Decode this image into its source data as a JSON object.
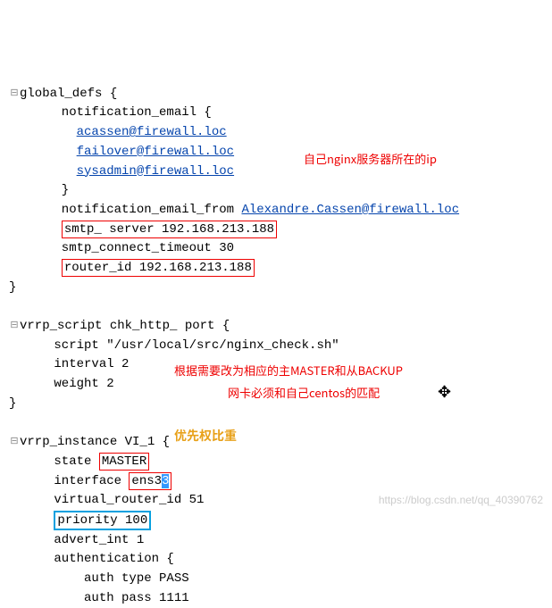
{
  "lines": {
    "l1a": "global_defs {",
    "l2": "       notification_email {",
    "l3": "         ",
    "l3b": "acassen@firewall.loc",
    "l4": "         ",
    "l4b": "failover@firewall.loc",
    "l5": "         ",
    "l5b": "sysadmin@firewall.loc",
    "l6": "       }",
    "l7": "       notification_email_from ",
    "l7b": "Alexandre.Cassen@firewall.loc",
    "l8": "smtp_ server 192.168.213.188",
    "l9": "       smtp_connect_timeout 30",
    "l10": "router_id 192.168.213.188",
    "l11": "}",
    "l12": "vrrp_script chk_http_ port {",
    "l13": "      script \"/usr/local/src/nginx_check.sh\"",
    "l14": "      interval 2",
    "l15": "      weight 2",
    "l16": "}",
    "l17": "vrrp_instance VI_1 {",
    "l18a": "      state ",
    "l18b": "MASTER",
    "l19a": "      interface ",
    "l19b": "ens3",
    "l19c": "3",
    "l20": "      virtual_router_id 51",
    "l21": "priority 100",
    "l22": "      advert_int 1",
    "l23": "      authentication {",
    "l24": "          auth type PASS",
    "l25": "          auth pass 1111"
  },
  "annotations": {
    "a1": "自己nginx服务器所在的ip",
    "a2": "根据需要改为相应的主MASTER和从BACKUP",
    "a3": "网卡必须和自己centos的匹配",
    "a4": "优先权比重"
  },
  "icons": {
    "fold_minus": "⊟",
    "move": "✥"
  },
  "watermark": "https://blog.csdn.net/qq_40390762"
}
